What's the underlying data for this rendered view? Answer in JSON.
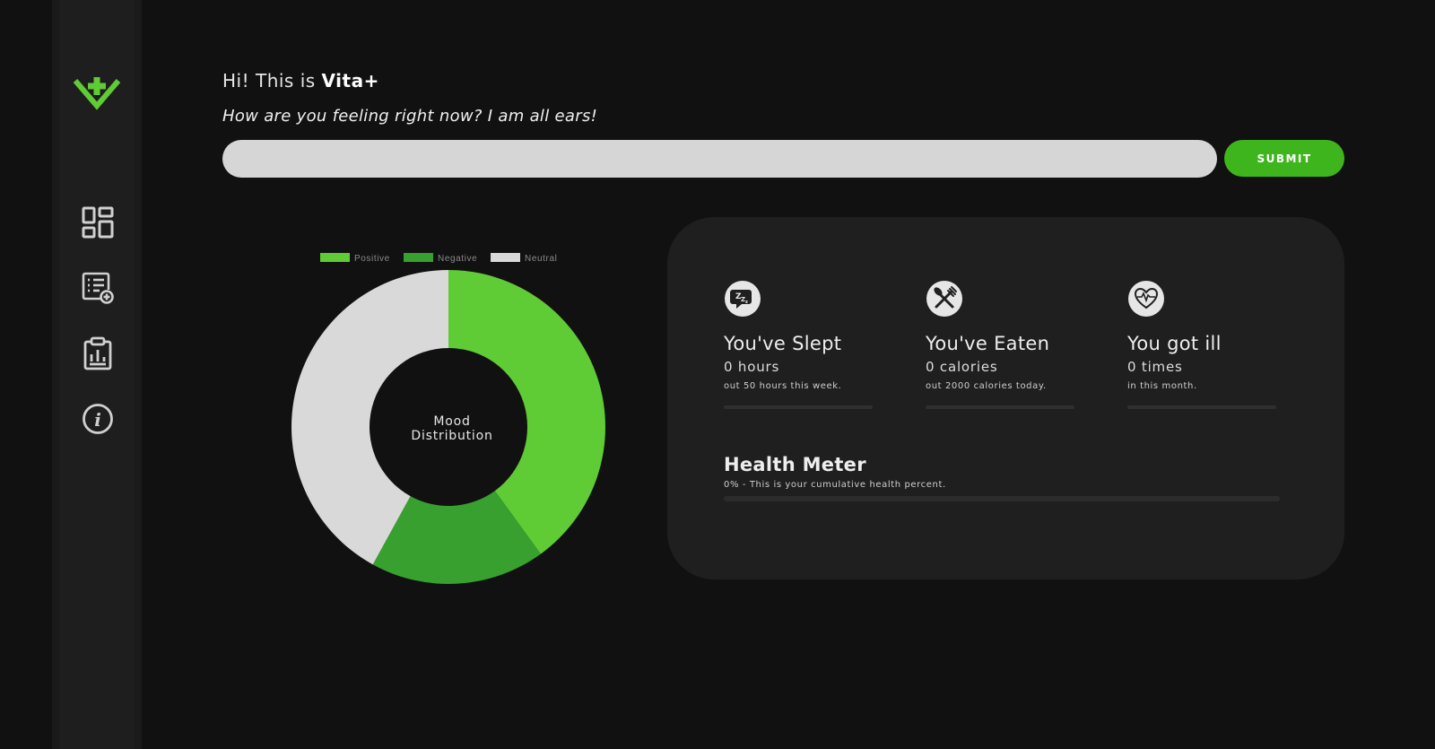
{
  "app": {
    "name": "Vita+"
  },
  "header": {
    "greeting_prefix": "Hi! This is",
    "greeting_brand": "Vita+",
    "prompt": "How are you feeling right now? I am all ears!"
  },
  "mood_form": {
    "input_value": "",
    "input_placeholder": "",
    "submit_label": "SUBMIT"
  },
  "sidebar": {
    "items": [
      {
        "icon": "dashboard-icon"
      },
      {
        "icon": "add-entry-icon"
      },
      {
        "icon": "report-clipboard-icon"
      },
      {
        "icon": "info-icon"
      }
    ]
  },
  "colors": {
    "accent": "#5fcb35",
    "accent_dark": "#38a02f",
    "neutral": "#d9d9d9",
    "background": "#111111",
    "panel": "#1f1f1f",
    "button": "#3fb51d"
  },
  "chart_data": {
    "type": "pie",
    "variant": "doughnut",
    "center_label_line1": "Mood",
    "center_label_line2": "Distribution",
    "legend_position": "top",
    "series": [
      {
        "name": "Positive",
        "value": 40,
        "color": "#5fcb35"
      },
      {
        "name": "Negative",
        "value": 18,
        "color": "#38a02f"
      },
      {
        "name": "Neutral",
        "value": 42,
        "color": "#d9d9d9"
      }
    ]
  },
  "stats": [
    {
      "icon": "sleep-icon",
      "title": "You've Slept",
      "value": "0 hours",
      "sub": "out 50 hours this week.",
      "progress": 0
    },
    {
      "icon": "fork-knife-icon",
      "title": "You've Eaten",
      "value": "0 calories",
      "sub": "out 2000 calories today.",
      "progress": 0
    },
    {
      "icon": "heartbeat-icon",
      "title": "You got ill",
      "value": "0 times",
      "sub": "in this month.",
      "progress": 0
    }
  ],
  "health_meter": {
    "title": "Health Meter",
    "sub": "0% - This is your cumulative health percent.",
    "progress": 0
  }
}
